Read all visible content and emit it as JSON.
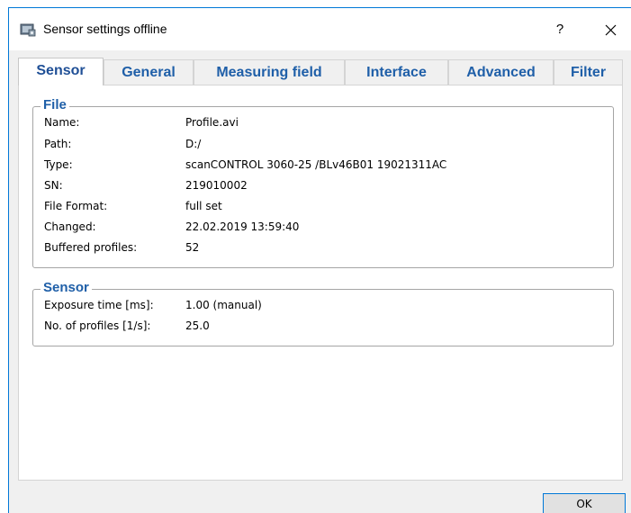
{
  "window": {
    "title": "Sensor settings offline",
    "help_label": "?",
    "app_icon": "sensor-settings-icon",
    "close_icon": "close-icon"
  },
  "tabs": [
    {
      "label": "Sensor",
      "active": true
    },
    {
      "label": "General",
      "active": false
    },
    {
      "label": "Measuring field",
      "active": false
    },
    {
      "label": "Interface",
      "active": false
    },
    {
      "label": "Advanced",
      "active": false
    },
    {
      "label": "Filter",
      "active": false
    }
  ],
  "file_group": {
    "title": "File",
    "rows": [
      {
        "label": "Name:",
        "value": "Profile.avi"
      },
      {
        "label": "Path:",
        "value": "D:/"
      },
      {
        "label": "Type:",
        "value": "scanCONTROL 3060-25 /BLv46B01  19021311AC"
      },
      {
        "label": "SN:",
        "value": "219010002"
      },
      {
        "label": "File Format:",
        "value": "full set"
      },
      {
        "label": "Changed:",
        "value": "22.02.2019 13:59:40"
      },
      {
        "label": "Buffered profiles:",
        "value": "52"
      }
    ]
  },
  "sensor_group": {
    "title": "Sensor",
    "rows": [
      {
        "label": "Exposure time [ms]:",
        "value": "1.00 (manual)"
      },
      {
        "label": "No. of profiles [1/s]:",
        "value": "25.0"
      }
    ]
  },
  "footer": {
    "ok_label": "OK"
  },
  "colors": {
    "accent": "#0078d7",
    "tab_text": "#1f5fa8",
    "client_bg": "#f0f0f0"
  }
}
